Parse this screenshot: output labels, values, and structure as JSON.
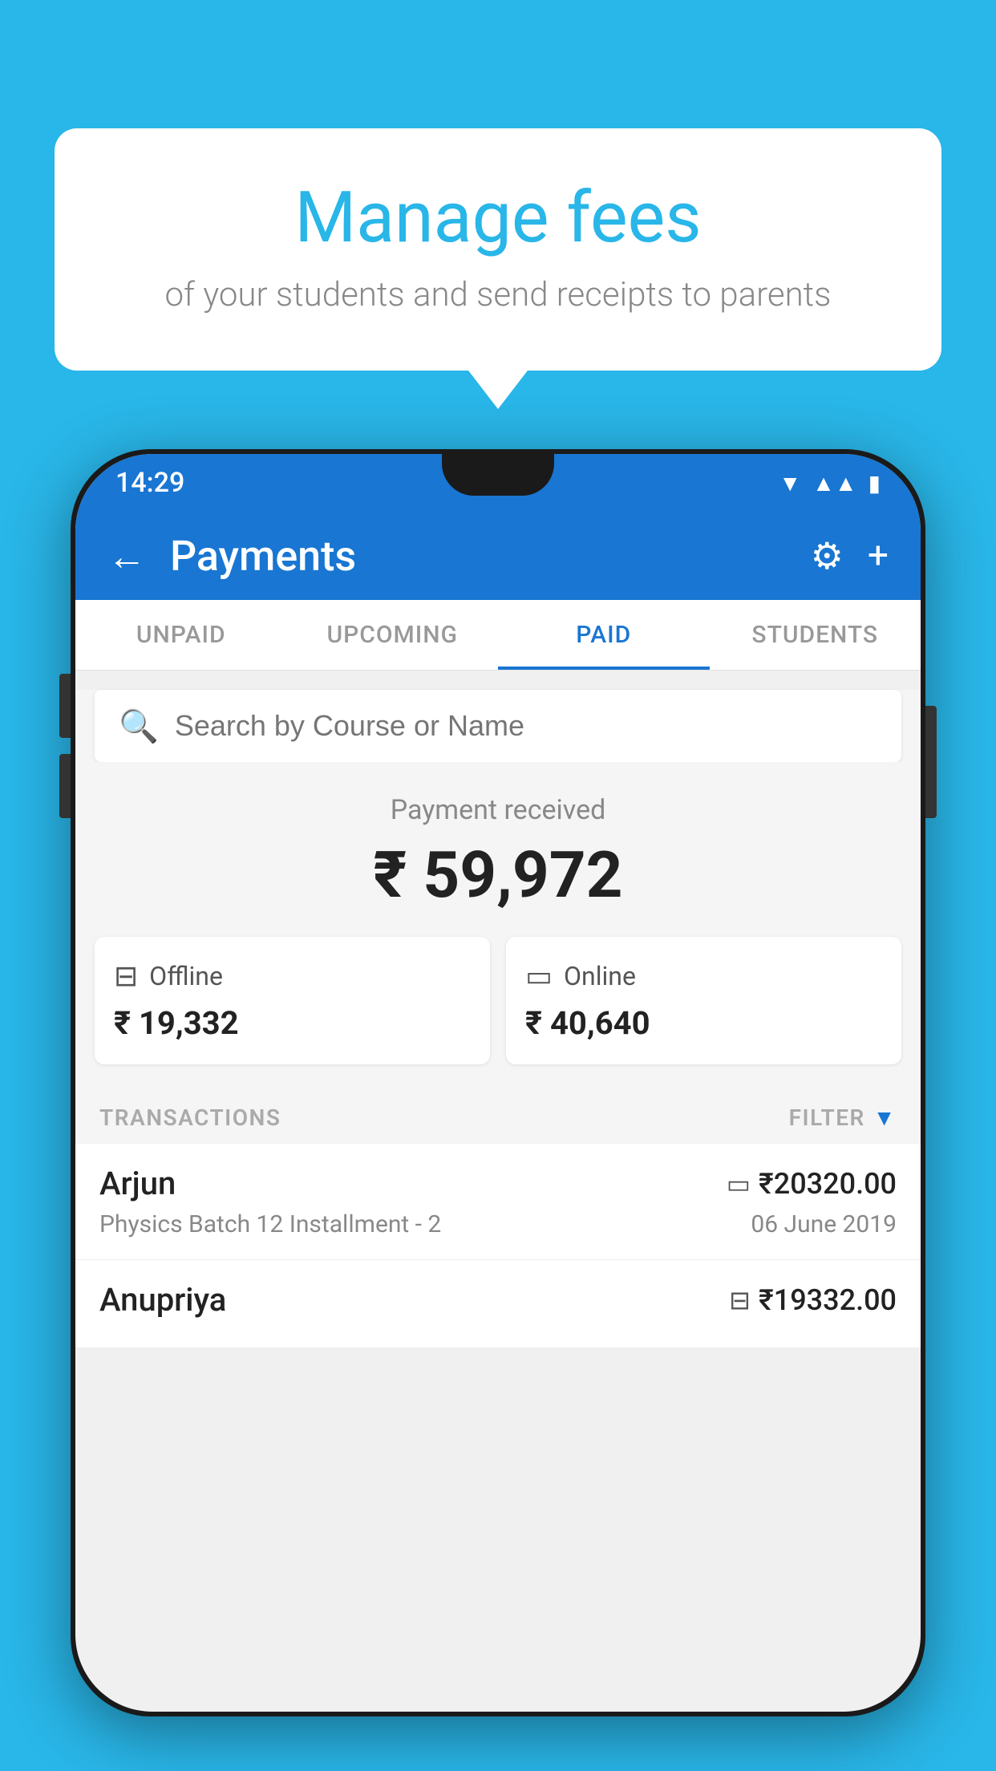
{
  "page": {
    "background_color": "#29B6E8"
  },
  "speech_bubble": {
    "title": "Manage fees",
    "subtitle": "of your students and send receipts to parents"
  },
  "status_bar": {
    "time": "14:29",
    "wifi_icon": "wifi",
    "signal_icon": "signal",
    "battery_icon": "battery"
  },
  "app_bar": {
    "back_label": "←",
    "title": "Payments",
    "gear_icon": "gear",
    "plus_icon": "+"
  },
  "tabs": [
    {
      "id": "unpaid",
      "label": "UNPAID",
      "active": false
    },
    {
      "id": "upcoming",
      "label": "UPCOMING",
      "active": false
    },
    {
      "id": "paid",
      "label": "PAID",
      "active": true
    },
    {
      "id": "students",
      "label": "STUDENTS",
      "active": false
    }
  ],
  "search": {
    "placeholder": "Search by Course or Name"
  },
  "payment_summary": {
    "label": "Payment received",
    "total_amount": "₹ 59,972",
    "offline": {
      "icon": "offline-payment",
      "label": "Offline",
      "amount": "₹ 19,332"
    },
    "online": {
      "icon": "online-payment",
      "label": "Online",
      "amount": "₹ 40,640"
    }
  },
  "transactions_section": {
    "label": "TRANSACTIONS",
    "filter_label": "FILTER"
  },
  "transactions": [
    {
      "student_name": "Arjun",
      "course": "Physics Batch 12 Installment - 2",
      "amount": "₹20320.00",
      "date": "06 June 2019",
      "payment_type": "card"
    },
    {
      "student_name": "Anupriya",
      "course": "",
      "amount": "₹19332.00",
      "date": "",
      "payment_type": "offline"
    }
  ]
}
